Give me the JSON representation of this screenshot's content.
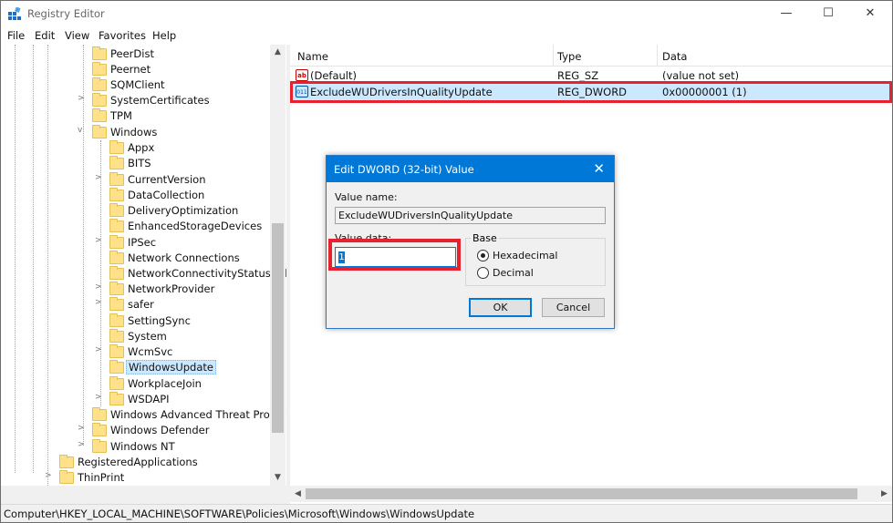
{
  "window": {
    "title": "Registry Editor",
    "controls": {
      "minimize": "—",
      "maximize": "☐",
      "close": "✕"
    }
  },
  "menu": [
    "File",
    "Edit",
    "View",
    "Favorites",
    "Help"
  ],
  "tree": {
    "items": [
      {
        "label": "PeerDist",
        "expander": ""
      },
      {
        "label": "Peernet",
        "expander": ""
      },
      {
        "label": "SQMClient",
        "expander": ""
      },
      {
        "label": "SystemCertificates",
        "expander": ">"
      },
      {
        "label": "TPM",
        "expander": ""
      },
      {
        "label": "Windows",
        "expander": "v"
      },
      {
        "label": "Appx",
        "expander": ""
      },
      {
        "label": "BITS",
        "expander": ""
      },
      {
        "label": "CurrentVersion",
        "expander": ">"
      },
      {
        "label": "DataCollection",
        "expander": ""
      },
      {
        "label": "DeliveryOptimization",
        "expander": ""
      },
      {
        "label": "EnhancedStorageDevices",
        "expander": ""
      },
      {
        "label": "IPSec",
        "expander": ">"
      },
      {
        "label": "Network Connections",
        "expander": ""
      },
      {
        "label": "NetworkConnectivityStatusIndi",
        "expander": ""
      },
      {
        "label": "NetworkProvider",
        "expander": ">"
      },
      {
        "label": "safer",
        "expander": ">"
      },
      {
        "label": "SettingSync",
        "expander": ""
      },
      {
        "label": "System",
        "expander": ""
      },
      {
        "label": "WcmSvc",
        "expander": ">"
      },
      {
        "label": "WindowsUpdate",
        "expander": ""
      },
      {
        "label": "WorkplaceJoin",
        "expander": ""
      },
      {
        "label": "WSDAPI",
        "expander": ">"
      },
      {
        "label": "Windows Advanced Threat Protect",
        "expander": ""
      },
      {
        "label": "Windows Defender",
        "expander": ">"
      },
      {
        "label": "Windows NT",
        "expander": ">"
      },
      {
        "label": "RegisteredApplications",
        "expander": ""
      },
      {
        "label": "ThinPrint",
        "expander": ">"
      }
    ],
    "scroll_up": "▲",
    "scroll_down": "▼"
  },
  "list": {
    "columns": {
      "name": "Name",
      "type": "Type",
      "data": "Data"
    },
    "rows": [
      {
        "name": "(Default)",
        "type": "REG_SZ",
        "data": "(value not set)",
        "icon": "string-value-icon",
        "icon_text": "ab"
      },
      {
        "name": "ExcludeWUDriversInQualityUpdate",
        "type": "REG_DWORD",
        "data": "0x00000001 (1)",
        "icon": "dword-value-icon",
        "icon_text": "011"
      }
    ],
    "scroll_left": "◀",
    "scroll_right": "▶"
  },
  "status": {
    "path": "Computer\\HKEY_LOCAL_MACHINE\\SOFTWARE\\Policies\\Microsoft\\Windows\\WindowsUpdate"
  },
  "dialog": {
    "title": "Edit DWORD (32-bit) Value",
    "close": "✕",
    "value_name_label": "Value name:",
    "value_name": "ExcludeWUDriversInQualityUpdate",
    "value_data_label": "Value data:",
    "value_data": "1",
    "base_label": "Base",
    "hex_label": "Hexadecimal",
    "dec_label": "Decimal",
    "ok": "OK",
    "cancel": "Cancel"
  },
  "colors": {
    "accent": "#0078d7",
    "highlight": "#e8212e",
    "selection": "#cce8ff"
  }
}
